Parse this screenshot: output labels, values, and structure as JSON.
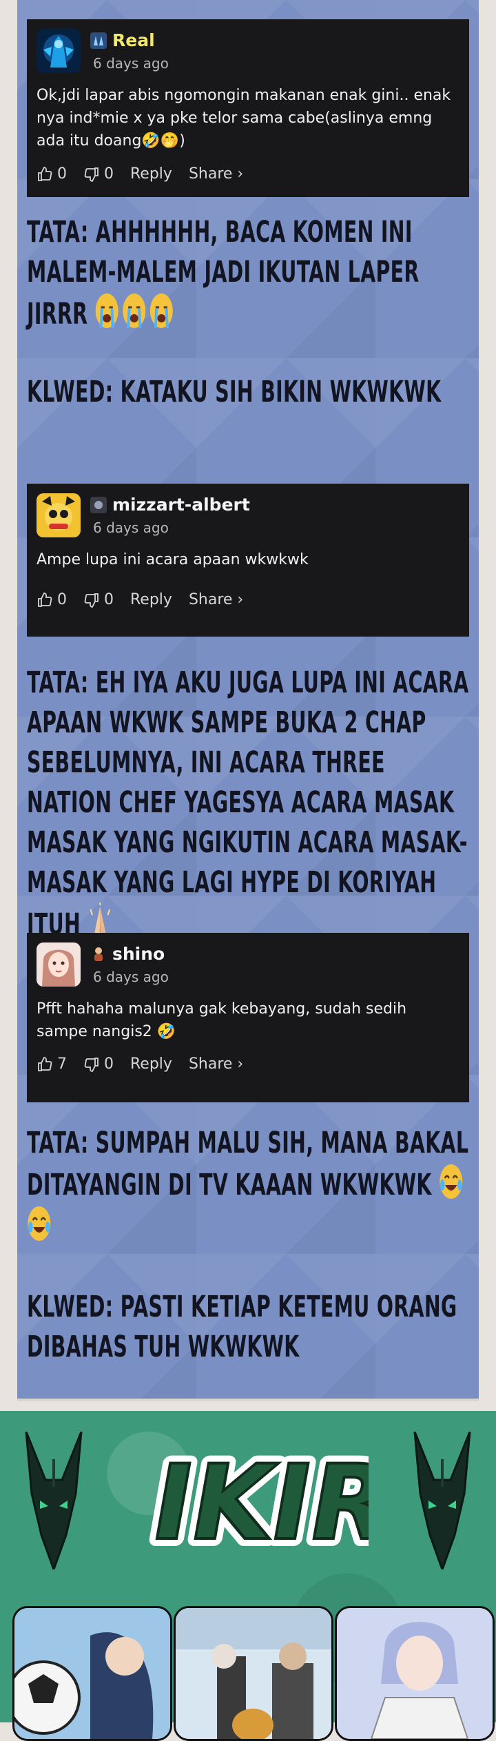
{
  "comments": [
    {
      "username": "Real",
      "time": "6 days ago",
      "text": "Ok,jdi lapar abis ngomongin makanan enak gini.. enak nya ind*mie x ya pke telor sama cabe(aslinya emng ada itu doang🤣🤭)",
      "likes": "0",
      "dislikes": "0",
      "reply": "Reply",
      "share": "Share ›",
      "username_color": "#f2e86b"
    },
    {
      "username": "mizzart-albert",
      "time": "6 days ago",
      "text": "Ampe lupa ini acara apaan wkwkwk",
      "likes": "0",
      "dislikes": "0",
      "reply": "Reply",
      "share": "Share ›",
      "username_color": "#f5f5f5"
    },
    {
      "username": "shino",
      "time": "6 days ago",
      "text": "Pfft hahaha malunya gak kebayang, sudah sedih sampe nangis2 🤣",
      "likes": "7",
      "dislikes": "0",
      "reply": "Reply",
      "share": "Share ›",
      "username_color": "#f5f5f5"
    }
  ],
  "captions": {
    "c1": "TATA: AHHHHHH, BACA KOMEN INI MALEM-MALEM JADI IKUTAN LAPER JIRRR",
    "c2": "KLWED: KATAKU SIH BIKIN WKWKWK",
    "c3": "TATA: EH IYA AKU JUGA LUPA INI ACARA APAAN WKWK SAMPE BUKA 2 CHAP SEBELUMNYA, INI ACARA THREE NATION CHEF YAGESYA ACARA MASAK MASAK YANG NGIKUTIN ACARA MASAK-MASAK YANG LAGI HYPE DI KORIYAH ITUH",
    "c4": "TATA: SUMPAH MALU SIH, MANA BAKAL DITAYANGIN DI TV KAAAN WKWKWK",
    "c5": "KLWED: PASTI KETIAP KETEMU ORANG DIBAHAS TUH WKWKWK"
  },
  "banner": {
    "logo_text": "IKIRU"
  },
  "colors": {
    "panel_bg": "#7a90c4",
    "comment_bg": "#18181b",
    "caption_text": "#121521",
    "banner_bg": "#3d9b7b"
  },
  "icons": [
    "thumbs-up-icon",
    "thumbs-down-icon",
    "loudly-crying-emoji",
    "tears-of-joy-emoji",
    "folded-hands-emoji",
    "anubis-mascot"
  ]
}
